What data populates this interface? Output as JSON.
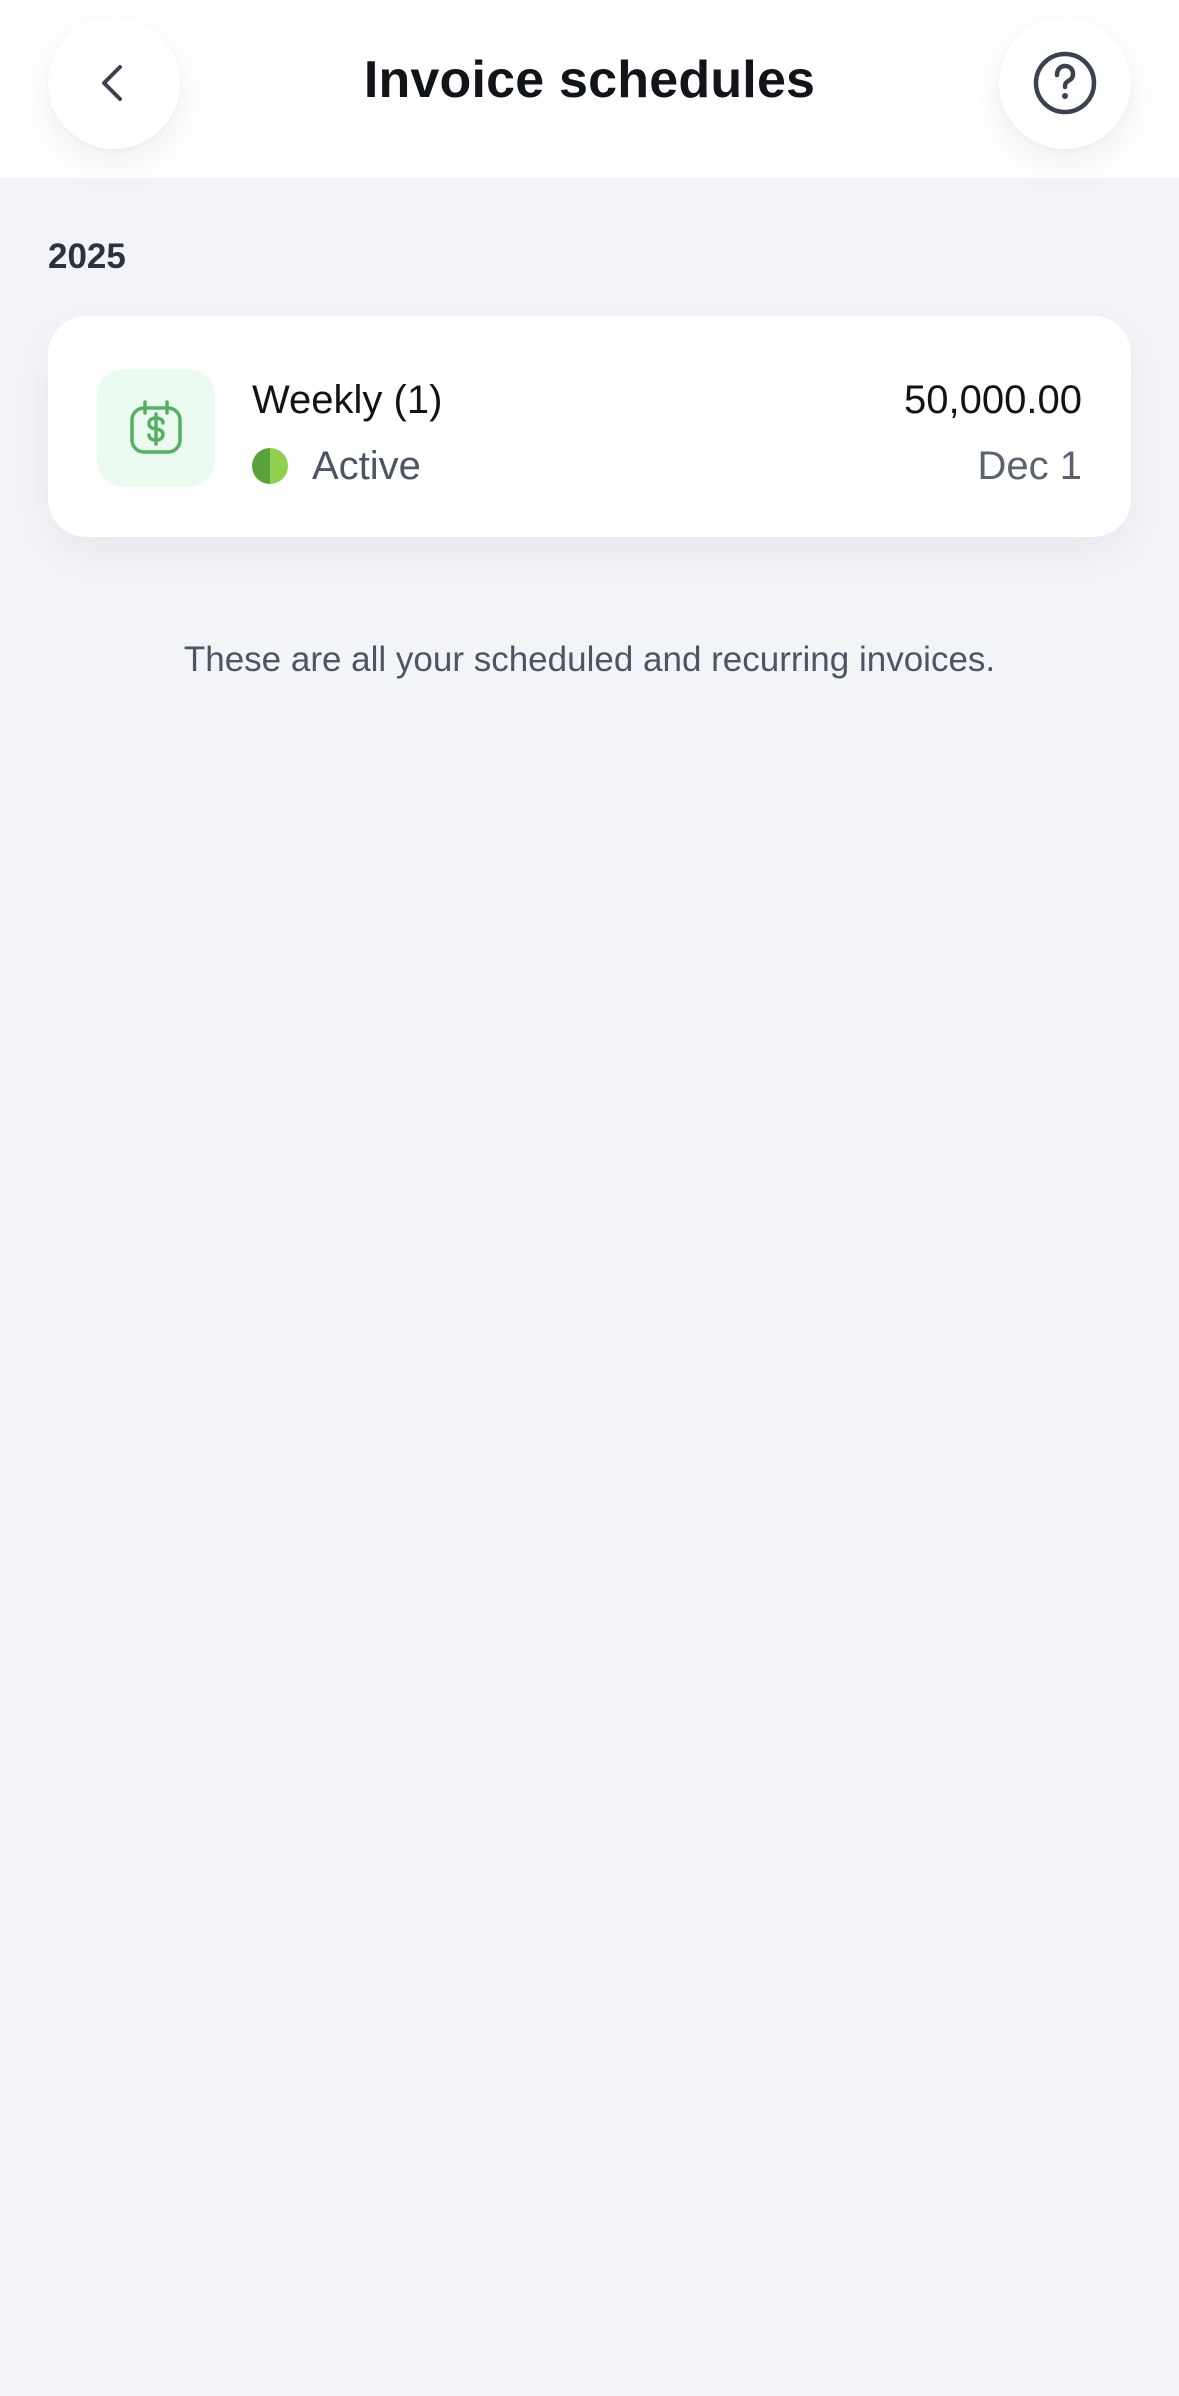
{
  "header": {
    "title": "Invoice schedules",
    "back_icon": "chevron-left-icon",
    "help_icon": "question-circle-icon"
  },
  "section": {
    "year": "2025"
  },
  "schedules": [
    {
      "title": "Weekly (1)",
      "status": "Active",
      "amount": "50,000.00",
      "date": "Dec 1",
      "icon": "calendar-dollar-icon"
    }
  ],
  "footnote": "These are all your scheduled and recurring invoices.",
  "colors": {
    "background": "#f2f4f8",
    "card": "#ffffff",
    "icon_bg": "#ecfbef",
    "icon_green": "#55b065",
    "status_dark_green": "#5aa33a",
    "status_light_green": "#8fd14f",
    "text_primary": "#101418",
    "text_secondary": "#4b5563"
  }
}
